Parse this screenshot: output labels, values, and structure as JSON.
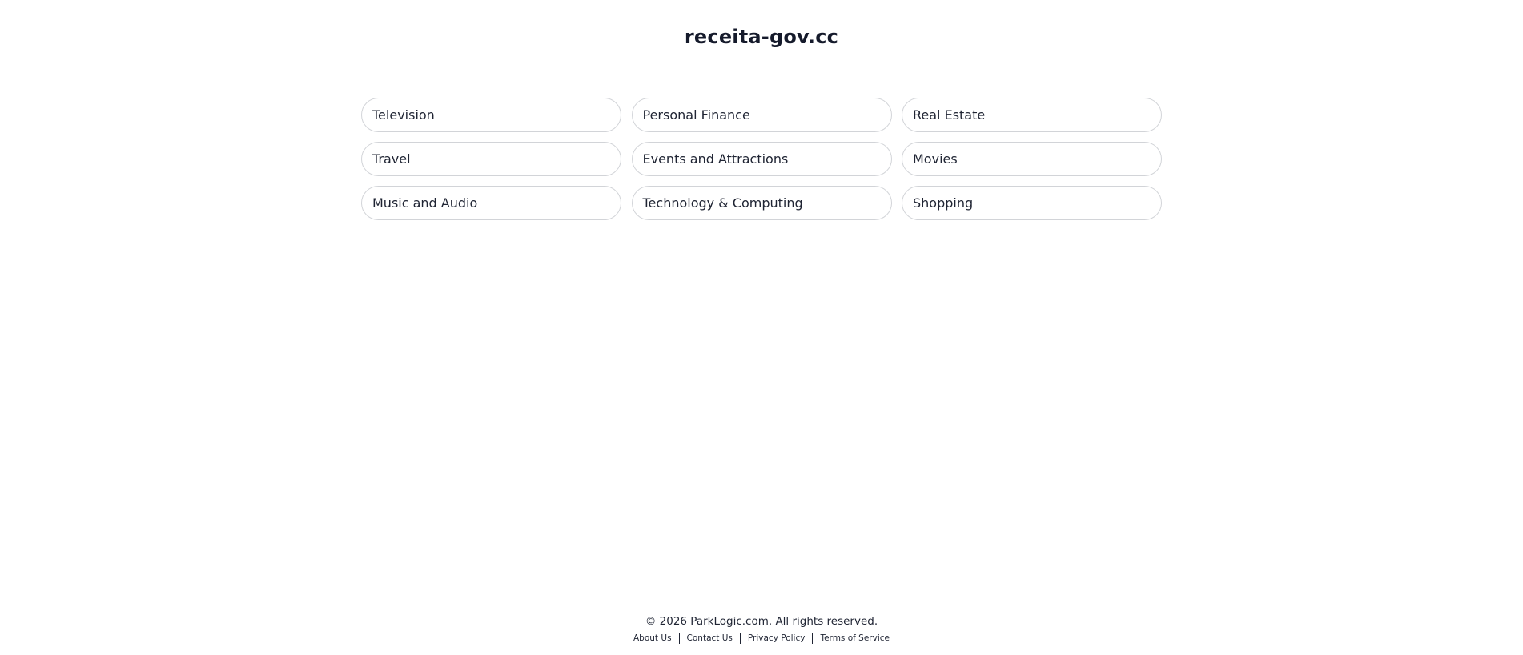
{
  "header": {
    "site_title": "receita-gov.cc"
  },
  "categories": [
    {
      "label": "Television"
    },
    {
      "label": "Personal Finance"
    },
    {
      "label": "Real Estate"
    },
    {
      "label": "Travel"
    },
    {
      "label": "Events and Attractions"
    },
    {
      "label": "Movies"
    },
    {
      "label": "Music and Audio"
    },
    {
      "label": "Technology & Computing"
    },
    {
      "label": "Shopping"
    }
  ],
  "footer": {
    "copyright": "© 2026 ParkLogic.com. All rights reserved.",
    "links": [
      {
        "label": "About Us"
      },
      {
        "label": "Contact Us"
      },
      {
        "label": "Privacy Policy"
      },
      {
        "label": "Terms of Service"
      }
    ]
  },
  "colors": {
    "text": "#1f2433",
    "border": "#d2d4d8",
    "background": "#ffffff"
  }
}
